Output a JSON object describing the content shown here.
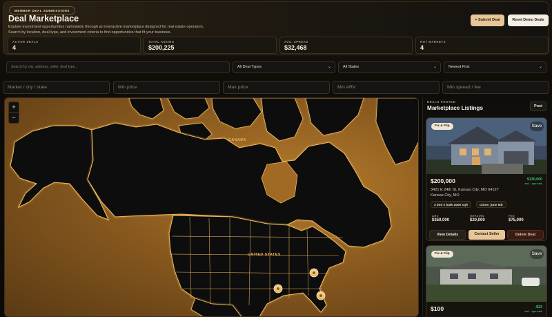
{
  "header": {
    "badge": "MEMBER DEAL SUBMISSIONS",
    "title": "Deal Marketplace",
    "description": "Explore investment opportunities nationwide through an interactive marketplace designed for real estate operators. Search by location, deal type, and investment criteria to find opportunities that fit your business.",
    "submit_label": "+ Submit Deal",
    "reset_label": "Reset Demo Deals"
  },
  "stats": [
    {
      "label": "ACTIVE DEALS",
      "value": "4"
    },
    {
      "label": "TOTAL ASKING",
      "value": "$200,225"
    },
    {
      "label": "AVG. SPREAD",
      "value": "$32,468"
    },
    {
      "label": "HOT MARKETS",
      "value": "4"
    }
  ],
  "filters": {
    "search_placeholder": "Search by city, address, seller, deal type...",
    "deal_types": "All Deal Types",
    "states": "All States",
    "sort": "Newest First",
    "market_placeholder": "Market / city / state",
    "min_price_placeholder": "Min price",
    "max_price_placeholder": "Max price",
    "min_arv_placeholder": "Min ARV",
    "min_spread_placeholder": "Min spread / fee"
  },
  "map": {
    "zoom_in": "+",
    "zoom_out": "−",
    "label_canada": "CANADA",
    "label_us": "UNITED STATES"
  },
  "sidebar": {
    "subtitle": "DEALS POSTED",
    "title": "Marketplace Listings",
    "post_label": "Post"
  },
  "listings": [
    {
      "tag": "Fix & Flip",
      "save": "Save",
      "price": "$200,000",
      "spread_value": "$130,000",
      "spread_label": "est. spread",
      "address1": "3421 E 24th St, Kansas City, MO 64127",
      "address2": "Kansas City, MO",
      "chip1": "3 bed 2 bath 2000 sqft",
      "chip2": "Close: june 5th",
      "arv_label": "ARV",
      "arv_value": "$350,000",
      "repairs_label": "REPAIRS",
      "repairs_value": "$20,000",
      "fee_label": "FEE",
      "fee_value": "$75,000",
      "view_label": "View Details",
      "contact_label": "Contact Seller",
      "delete_label": "Delete Deal"
    },
    {
      "tag": "Fix & Flip",
      "save": "Save",
      "price": "$100",
      "spread_value": "-$23",
      "spread_label": "est. spread"
    }
  ],
  "colors": {
    "accent": "#e7c79a",
    "map_glow": "#f0b85a",
    "spread_green": "#43c07a"
  }
}
